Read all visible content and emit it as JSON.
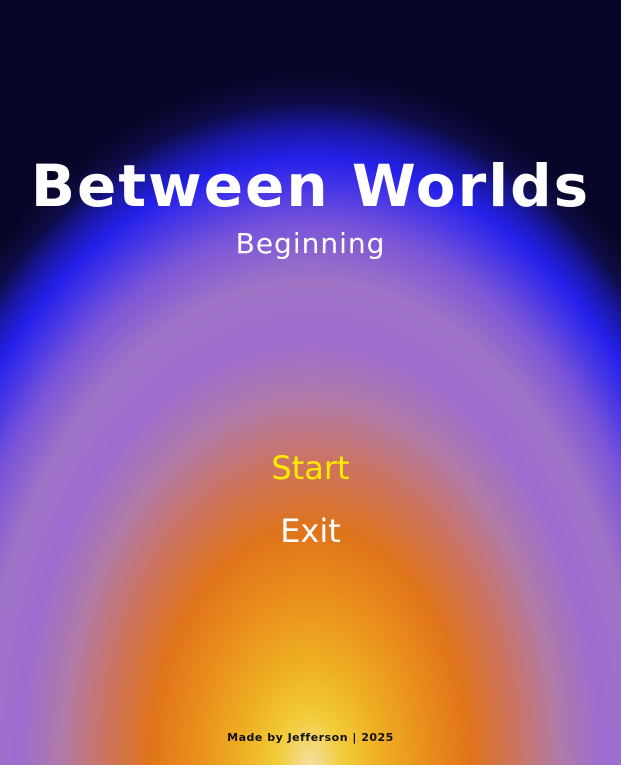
{
  "game": {
    "title": "Between Worlds",
    "subtitle": "Beginning"
  },
  "menu": {
    "start_label": "Start",
    "exit_label": "Exit",
    "selected": "Start",
    "selected_color": "#ffea00",
    "default_color": "#ffffff"
  },
  "footer": {
    "credit": "Made by Jefferson | 2025"
  },
  "colors": {
    "background_top": "#080628",
    "glow_blue": "#2420ea",
    "glow_purple": "#9c6cd0",
    "glow_orange": "#e0741a",
    "glow_yellow": "#f2cc3a"
  }
}
